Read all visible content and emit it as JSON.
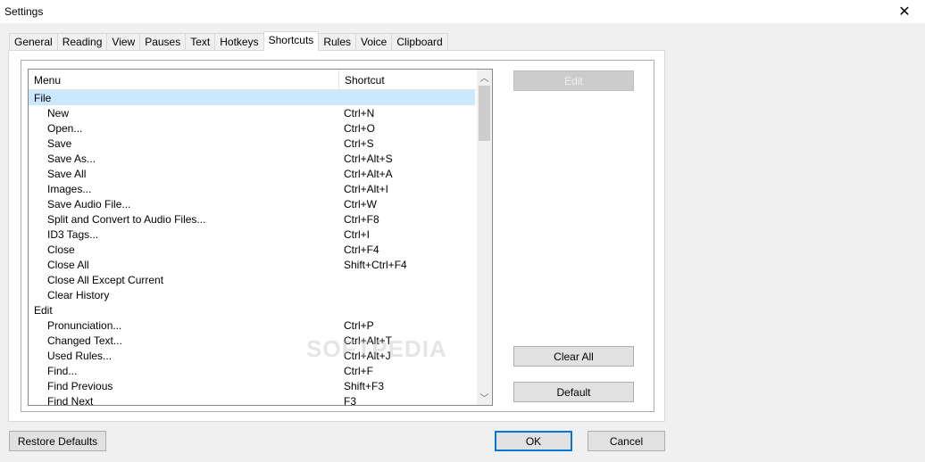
{
  "window": {
    "title": "Settings"
  },
  "tabs": [
    {
      "label": "General"
    },
    {
      "label": "Reading"
    },
    {
      "label": "View"
    },
    {
      "label": "Pauses"
    },
    {
      "label": "Text"
    },
    {
      "label": "Hotkeys"
    },
    {
      "label": "Shortcuts",
      "active": true
    },
    {
      "label": "Rules"
    },
    {
      "label": "Voice"
    },
    {
      "label": "Clipboard"
    }
  ],
  "shortcuts": {
    "columns": {
      "menu": "Menu",
      "shortcut": "Shortcut"
    },
    "rows": [
      {
        "menu": "File",
        "shortcut": "",
        "group": true,
        "selected": true
      },
      {
        "menu": "New",
        "shortcut": "Ctrl+N"
      },
      {
        "menu": "Open...",
        "shortcut": "Ctrl+O"
      },
      {
        "menu": "Save",
        "shortcut": "Ctrl+S"
      },
      {
        "menu": "Save As...",
        "shortcut": "Ctrl+Alt+S"
      },
      {
        "menu": "Save All",
        "shortcut": "Ctrl+Alt+A"
      },
      {
        "menu": "Images...",
        "shortcut": "Ctrl+Alt+I"
      },
      {
        "menu": "Save Audio File...",
        "shortcut": "Ctrl+W"
      },
      {
        "menu": "Split and Convert to Audio Files...",
        "shortcut": "Ctrl+F8"
      },
      {
        "menu": "ID3 Tags...",
        "shortcut": "Ctrl+I"
      },
      {
        "menu": "Close",
        "shortcut": "Ctrl+F4"
      },
      {
        "menu": "Close All",
        "shortcut": "Shift+Ctrl+F4"
      },
      {
        "menu": "Close All Except Current",
        "shortcut": ""
      },
      {
        "menu": "Clear History",
        "shortcut": ""
      },
      {
        "menu": "Edit",
        "shortcut": "",
        "group": true
      },
      {
        "menu": "Pronunciation...",
        "shortcut": "Ctrl+P"
      },
      {
        "menu": "Changed Text...",
        "shortcut": "Ctrl+Alt+T"
      },
      {
        "menu": "Used Rules...",
        "shortcut": "Ctrl+Alt+J"
      },
      {
        "menu": "Find...",
        "shortcut": "Ctrl+F"
      },
      {
        "menu": "Find Previous",
        "shortcut": "Shift+F3"
      },
      {
        "menu": "Find Next",
        "shortcut": "F3"
      }
    ]
  },
  "buttons": {
    "edit": "Edit",
    "clear_all": "Clear All",
    "default": "Default",
    "restore_defaults": "Restore Defaults",
    "ok": "OK",
    "cancel": "Cancel"
  },
  "watermark": "SOFTPEDIA",
  "icons": {
    "close": "close-icon",
    "scroll_up": "chevron-up-icon",
    "scroll_down": "chevron-down-icon"
  }
}
